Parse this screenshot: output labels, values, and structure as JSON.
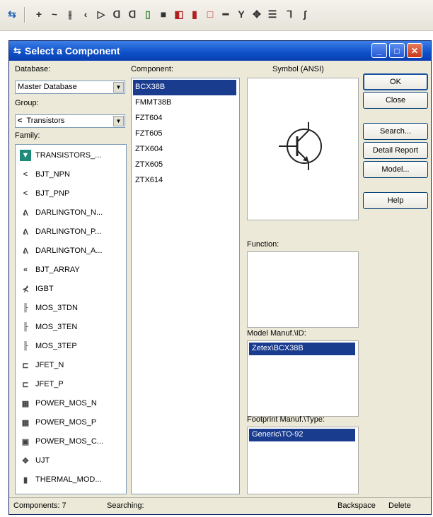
{
  "toolbar": {
    "icons": [
      "layout-icon",
      "probe-icon",
      "resistor-icon",
      "capacitor-icon",
      "diode-icon",
      "transistor-icon",
      "analog-icon",
      "ttl-icon",
      "cmos-icon",
      "misc-digital-icon",
      "mixed-icon",
      "indicator-icon",
      "power-icon",
      "misc-icon",
      "advanced-peripheral-icon",
      "rf-icon",
      "electromech-icon",
      "antenna-icon",
      "ni-icon",
      "bus-icon",
      "hierarchical-icon"
    ]
  },
  "dialog": {
    "title": "Select a Component",
    "database_label": "Database:",
    "database_value": "Master Database",
    "group_label": "Group:",
    "group_value": "Transistors",
    "family_label": "Family:",
    "component_label": "Component:",
    "symbol_label": "Symbol (ANSI)",
    "function_label": "Function:",
    "model_label": "Model Manuf.\\ID:",
    "model_value": "Zetex\\BCX38B",
    "footprint_label": "Footprint Manuf.\\Type:",
    "footprint_value": "Generic\\TO-92"
  },
  "family_items": [
    {
      "label": "TRANSISTORS_...",
      "icon": "all-transistors-icon",
      "glyph": "▼",
      "selected": true
    },
    {
      "label": "BJT_NPN",
      "icon": "bjt-npn-icon",
      "glyph": "<",
      "selected": false
    },
    {
      "label": "BJT_PNP",
      "icon": "bjt-pnp-icon",
      "glyph": "<",
      "selected": false
    },
    {
      "label": "DARLINGTON_N...",
      "icon": "darlington-npn-icon",
      "glyph": "ᕕ",
      "selected": false
    },
    {
      "label": "DARLINGTON_P...",
      "icon": "darlington-pnp-icon",
      "glyph": "ᕕ",
      "selected": false
    },
    {
      "label": "DARLINGTON_A...",
      "icon": "darlington-array-icon",
      "glyph": "ᕕ",
      "selected": false
    },
    {
      "label": "BJT_ARRAY",
      "icon": "bjt-array-icon",
      "glyph": "«",
      "selected": false
    },
    {
      "label": "IGBT",
      "icon": "igbt-icon",
      "glyph": "⊀",
      "selected": false
    },
    {
      "label": "MOS_3TDN",
      "icon": "mos-3tdn-icon",
      "glyph": "╟",
      "selected": false
    },
    {
      "label": "MOS_3TEN",
      "icon": "mos-3ten-icon",
      "glyph": "╟",
      "selected": false
    },
    {
      "label": "MOS_3TEP",
      "icon": "mos-3tep-icon",
      "glyph": "╟",
      "selected": false
    },
    {
      "label": "JFET_N",
      "icon": "jfet-n-icon",
      "glyph": "⊏",
      "selected": false
    },
    {
      "label": "JFET_P",
      "icon": "jfet-p-icon",
      "glyph": "⊏",
      "selected": false
    },
    {
      "label": "POWER_MOS_N",
      "icon": "power-mos-n-icon",
      "glyph": "▦",
      "selected": false
    },
    {
      "label": "POWER_MOS_P",
      "icon": "power-mos-p-icon",
      "glyph": "▦",
      "selected": false
    },
    {
      "label": "POWER_MOS_C...",
      "icon": "power-mos-comp-icon",
      "glyph": "▣",
      "selected": false
    },
    {
      "label": "UJT",
      "icon": "ujt-icon",
      "glyph": "✥",
      "selected": false
    },
    {
      "label": "THERMAL_MOD...",
      "icon": "thermal-model-icon",
      "glyph": "▮",
      "selected": false
    }
  ],
  "component_items": [
    {
      "label": "BCX38B",
      "selected": true
    },
    {
      "label": "FMMT38B",
      "selected": false
    },
    {
      "label": "FZT604",
      "selected": false
    },
    {
      "label": "FZT605",
      "selected": false
    },
    {
      "label": "ZTX604",
      "selected": false
    },
    {
      "label": "ZTX605",
      "selected": false
    },
    {
      "label": "ZTX614",
      "selected": false
    }
  ],
  "buttons": {
    "ok": "OK",
    "close": "Close",
    "search": "Search...",
    "detail_report": "Detail Report",
    "model": "Model...",
    "help": "Help"
  },
  "status": {
    "components": "Components: 7",
    "searching": "Searching:",
    "backspace": "Backspace",
    "delete": "Delete"
  },
  "colors": {
    "title_bar": "#0d4fc8",
    "selection": "#1a3c8e",
    "dialog_bg": "#ece9d8"
  }
}
